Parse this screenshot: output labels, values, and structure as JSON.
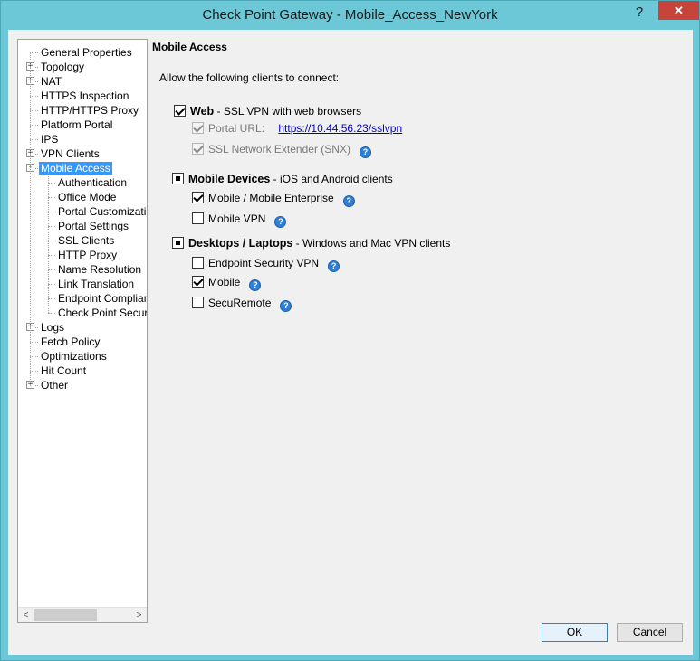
{
  "window": {
    "title": "Check Point Gateway - Mobile_Access_NewYork",
    "help_glyph": "?",
    "close_glyph": "✕"
  },
  "tree": {
    "items": [
      {
        "label": "General Properties",
        "level": 0,
        "expander": ""
      },
      {
        "label": "Topology",
        "level": 0,
        "expander": "+"
      },
      {
        "label": "NAT",
        "level": 0,
        "expander": "+"
      },
      {
        "label": "HTTPS Inspection",
        "level": 0,
        "expander": ""
      },
      {
        "label": "HTTP/HTTPS Proxy",
        "level": 0,
        "expander": ""
      },
      {
        "label": "Platform Portal",
        "level": 0,
        "expander": ""
      },
      {
        "label": "IPS",
        "level": 0,
        "expander": ""
      },
      {
        "label": "VPN Clients",
        "level": 0,
        "expander": "+"
      },
      {
        "label": "Mobile Access",
        "level": 0,
        "expander": "-",
        "selected": true
      },
      {
        "label": "Authentication",
        "level": 1,
        "expander": ""
      },
      {
        "label": "Office Mode",
        "level": 1,
        "expander": ""
      },
      {
        "label": "Portal Customizatio",
        "level": 1,
        "expander": ""
      },
      {
        "label": "Portal Settings",
        "level": 1,
        "expander": ""
      },
      {
        "label": "SSL Clients",
        "level": 1,
        "expander": ""
      },
      {
        "label": "HTTP Proxy",
        "level": 1,
        "expander": ""
      },
      {
        "label": "Name Resolution",
        "level": 1,
        "expander": ""
      },
      {
        "label": "Link Translation",
        "level": 1,
        "expander": ""
      },
      {
        "label": "Endpoint Complian",
        "level": 1,
        "expander": ""
      },
      {
        "label": "Check Point Secur",
        "level": 1,
        "expander": ""
      },
      {
        "label": "Logs",
        "level": 0,
        "expander": "+"
      },
      {
        "label": "Fetch Policy",
        "level": 0,
        "expander": ""
      },
      {
        "label": "Optimizations",
        "level": 0,
        "expander": ""
      },
      {
        "label": "Hit Count",
        "level": 0,
        "expander": ""
      },
      {
        "label": "Other",
        "level": 0,
        "expander": "+"
      }
    ],
    "scroll_left": "<",
    "scroll_right": ">"
  },
  "panel": {
    "title": "Mobile Access",
    "intro": "Allow the following clients to connect:",
    "web": {
      "label": "Web",
      "desc": " - SSL VPN with web browsers",
      "portal_url_label": "Portal URL:",
      "portal_url": "https://10.44.56.23/sslvpn",
      "snx_label": "SSL Network Extender (SNX)"
    },
    "mobile_devices": {
      "label": "Mobile Devices",
      "desc": " - iOS and Android clients",
      "mobile_enterprise_label": "Mobile / Mobile Enterprise",
      "mobile_vpn_label": "Mobile VPN"
    },
    "desktops": {
      "label": "Desktops / Laptops",
      "desc": " - Windows and Mac VPN clients",
      "endpoint_vpn_label": "Endpoint Security VPN",
      "mobile_label": "Mobile",
      "securemote_label": "SecuRemote"
    },
    "help_glyph": "?"
  },
  "buttons": {
    "ok": "OK",
    "cancel": "Cancel"
  }
}
